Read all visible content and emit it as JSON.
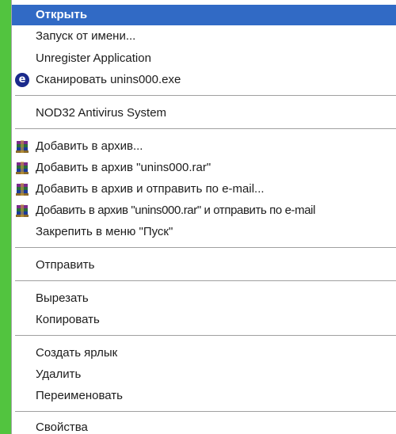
{
  "context_menu": {
    "items": [
      {
        "label": "Открыть",
        "icon": null,
        "highlighted": true
      },
      {
        "label": "Запуск от имени...",
        "icon": null
      },
      {
        "label": "Unregister Application",
        "icon": null
      },
      {
        "label": "Сканировать unins000.exe",
        "icon": "eset-scan-icon"
      },
      {
        "label": "NOD32 Antivirus System",
        "icon": null
      },
      {
        "label": "Добавить в архив...",
        "icon": "winrar-icon"
      },
      {
        "label": "Добавить в архив \"unins000.rar\"",
        "icon": "winrar-icon"
      },
      {
        "label": "Добавить в архив и отправить по e-mail...",
        "icon": "winrar-icon"
      },
      {
        "label": "Добавить в архив \"unins000.rar\" и отправить по e-mail",
        "icon": "winrar-icon"
      },
      {
        "label": "Закрепить в меню \"Пуск\"",
        "icon": null
      },
      {
        "label": "Отправить",
        "icon": null
      },
      {
        "label": "Вырезать",
        "icon": null
      },
      {
        "label": "Копировать",
        "icon": null
      },
      {
        "label": "Создать ярлык",
        "icon": null
      },
      {
        "label": "Удалить",
        "icon": null
      },
      {
        "label": "Переименовать",
        "icon": null
      },
      {
        "label": "Свойства",
        "icon": null
      }
    ]
  },
  "colors": {
    "highlight": "#316ac5",
    "frame": "#52c43f"
  }
}
